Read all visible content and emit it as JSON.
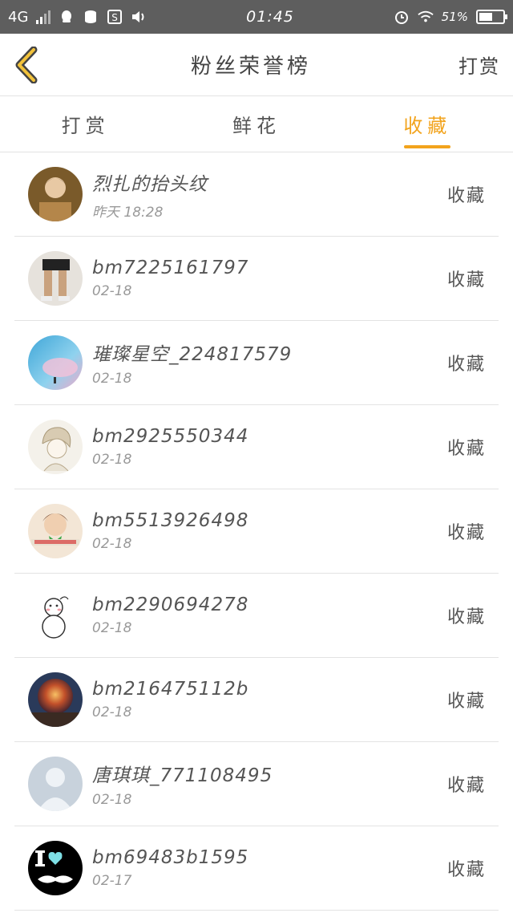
{
  "status_bar": {
    "network": "4G",
    "time": "01:45",
    "battery": "51%"
  },
  "header": {
    "title": "粉丝荣誉榜",
    "action_label": "打赏"
  },
  "tabs": [
    {
      "label": "打赏",
      "active": false
    },
    {
      "label": "鲜花",
      "active": false
    },
    {
      "label": "收藏",
      "active": true
    }
  ],
  "list": [
    {
      "name": "烈扎的抬头纹",
      "time": "昨天  18:28",
      "action": "收藏"
    },
    {
      "name": "bm7225161797",
      "time": "02-18",
      "action": "收藏"
    },
    {
      "name": "璀璨星空_224817579",
      "time": "02-18",
      "action": "收藏"
    },
    {
      "name": "bm2925550344",
      "time": "02-18",
      "action": "收藏"
    },
    {
      "name": "bm5513926498",
      "time": "02-18",
      "action": "收藏"
    },
    {
      "name": "bm2290694278",
      "time": "02-18",
      "action": "收藏"
    },
    {
      "name": "bm216475112b",
      "time": "02-18",
      "action": "收藏"
    },
    {
      "name": "唐琪琪_771108495",
      "time": "02-18",
      "action": "收藏"
    },
    {
      "name": "bm69483b1595",
      "time": "02-17",
      "action": "收藏"
    }
  ],
  "colors": {
    "accent": "#f2a31c",
    "status_bar": "#5e5e5e",
    "divider": "#e3e3e3"
  }
}
